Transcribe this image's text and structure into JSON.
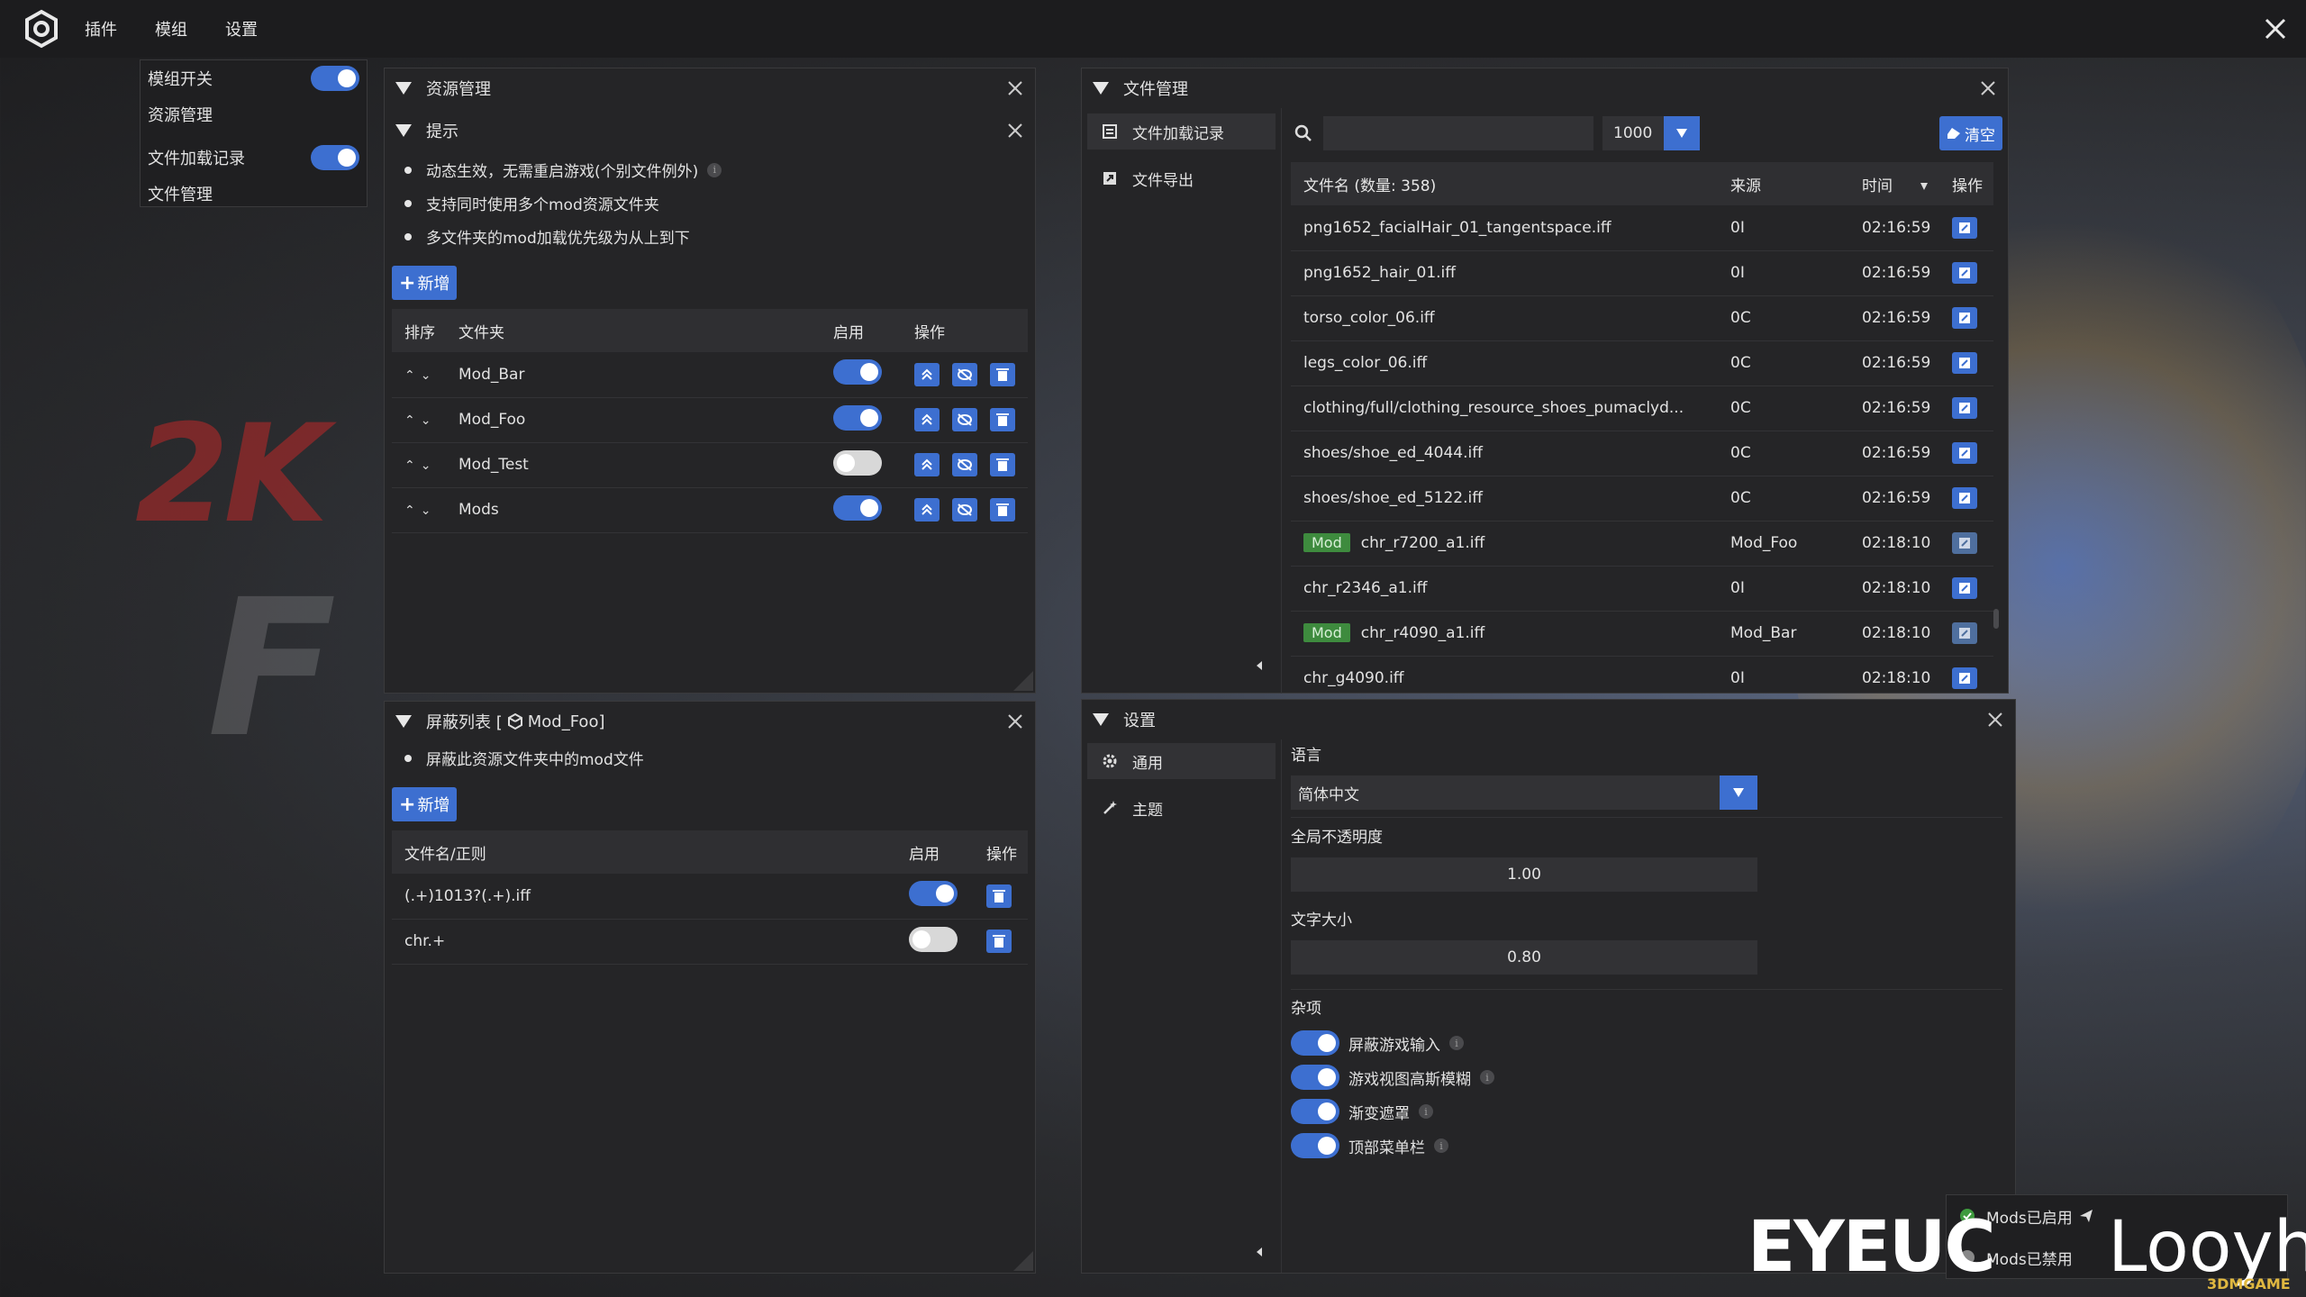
{
  "menubar": {
    "items": [
      "插件",
      "模组",
      "设置"
    ]
  },
  "dropdown": {
    "items": [
      {
        "label": "模组开关",
        "toggle": true
      },
      {
        "label": "资源管理",
        "toggle": null
      },
      {
        "label": "文件加载记录",
        "toggle": true
      },
      {
        "label": "文件管理",
        "toggle": null
      }
    ]
  },
  "resource_panel": {
    "title": "资源管理",
    "tip_title": "提示",
    "tips": [
      "动态生效，无需重启游戏(个别文件例外)",
      "支持同时使用多个mod资源文件夹",
      "多文件夹的mod加载优先级为从上到下"
    ],
    "add_label": "新增",
    "columns": [
      "排序",
      "文件夹",
      "启用",
      "操作"
    ],
    "rows": [
      {
        "folder": "Mod_Bar",
        "enabled": true
      },
      {
        "folder": "Mod_Foo",
        "enabled": true
      },
      {
        "folder": "Mod_Test",
        "enabled": false
      },
      {
        "folder": "Mods",
        "enabled": true
      }
    ]
  },
  "block_panel": {
    "title": "屏蔽列表 [",
    "title_mod": "Mod_Foo]",
    "tip": "屏蔽此资源文件夹中的mod文件",
    "add_label": "新增",
    "columns": [
      "文件名/正则",
      "启用",
      "操作"
    ],
    "rows": [
      {
        "pattern": "(.+)1013?(.+).iff",
        "enabled": true
      },
      {
        "pattern": "chr.+",
        "enabled": false
      }
    ]
  },
  "file_panel": {
    "title": "文件管理",
    "tabs": [
      "文件加载记录",
      "文件导出"
    ],
    "search_placeholder": "",
    "limit": "1000",
    "clear_label": "清空",
    "columns": [
      "文件名 (数量: 358)",
      "来源",
      "时间",
      "操作"
    ],
    "rows": [
      {
        "name": "png1652_facialHair_01_tangentspace.iff",
        "source": "0I",
        "time": "02:16:59",
        "mod": false
      },
      {
        "name": "png1652_hair_01.iff",
        "source": "0I",
        "time": "02:16:59",
        "mod": false
      },
      {
        "name": "torso_color_06.iff",
        "source": "0C",
        "time": "02:16:59",
        "mod": false
      },
      {
        "name": "legs_color_06.iff",
        "source": "0C",
        "time": "02:16:59",
        "mod": false
      },
      {
        "name": "clothing/full/clothing_resource_shoes_pumaclyd...",
        "source": "0C",
        "time": "02:16:59",
        "mod": false
      },
      {
        "name": "shoes/shoe_ed_4044.iff",
        "source": "0C",
        "time": "02:16:59",
        "mod": false
      },
      {
        "name": "shoes/shoe_ed_5122.iff",
        "source": "0C",
        "time": "02:16:59",
        "mod": false
      },
      {
        "name": "chr_r7200_a1.iff",
        "source": "Mod_Foo",
        "time": "02:18:10",
        "mod": true
      },
      {
        "name": "chr_r2346_a1.iff",
        "source": "0I",
        "time": "02:18:10",
        "mod": false
      },
      {
        "name": "chr_r4090_a1.iff",
        "source": "Mod_Bar",
        "time": "02:18:10",
        "mod": true
      },
      {
        "name": "chr_g4090.iff",
        "source": "0I",
        "time": "02:18:10",
        "mod": false
      }
    ],
    "mod_tag": "Mod"
  },
  "settings_panel": {
    "title": "设置",
    "tabs": [
      "通用",
      "主题"
    ],
    "language_label": "语言",
    "language_value": "简体中文",
    "opacity_label": "全局不透明度",
    "opacity_value": "1.00",
    "fontsize_label": "文字大小",
    "fontsize_value": "0.80",
    "misc_label": "杂项",
    "misc": [
      {
        "label": "屏蔽游戏输入",
        "on": true
      },
      {
        "label": "游戏视图高斯模糊",
        "on": true
      },
      {
        "label": "渐变遮罩",
        "on": true
      },
      {
        "label": "顶部菜单栏",
        "on": true
      }
    ]
  },
  "status": {
    "enabled": "Mods已启用",
    "disabled": "Mods已禁用"
  },
  "watermark": {
    "left": "EYEUC",
    "right": "Looyh",
    "small": "3DMGAME"
  },
  "background": {
    "logo_text": "2K",
    "big_letter": "F"
  },
  "colors": {
    "accent": "#3d6fd0",
    "mod_tag": "#3e8b3e",
    "panel": "#252527"
  }
}
